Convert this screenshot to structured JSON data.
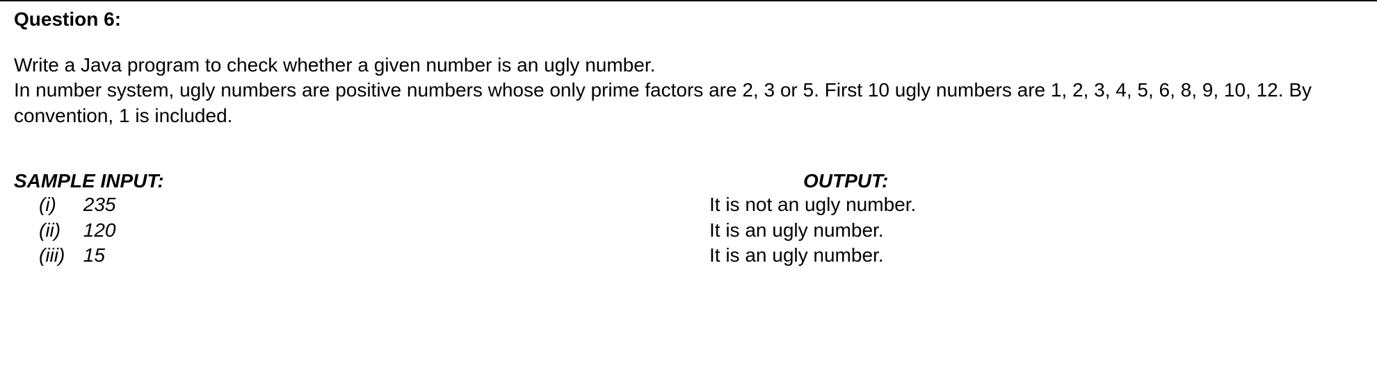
{
  "question": {
    "title": "Question 6:",
    "description_line1": "Write a Java program to check whether a given number is an ugly number.",
    "description_line2": "In number system, ugly numbers are positive numbers whose only prime factors are 2, 3 or 5. First 10 ugly numbers are 1, 2, 3, 4, 5, 6, 8, 9, 10, 12. By convention, 1 is included."
  },
  "sample": {
    "input_heading": "SAMPLE INPUT:",
    "output_heading": "OUTPUT:",
    "inputs": [
      {
        "marker": "(i)",
        "value": "235"
      },
      {
        "marker": "(ii)",
        "value": "120"
      },
      {
        "marker": "(iii)",
        "value": "15"
      }
    ],
    "outputs": [
      "It is not an ugly number.",
      "It is an ugly number.",
      "It is an ugly number."
    ]
  }
}
